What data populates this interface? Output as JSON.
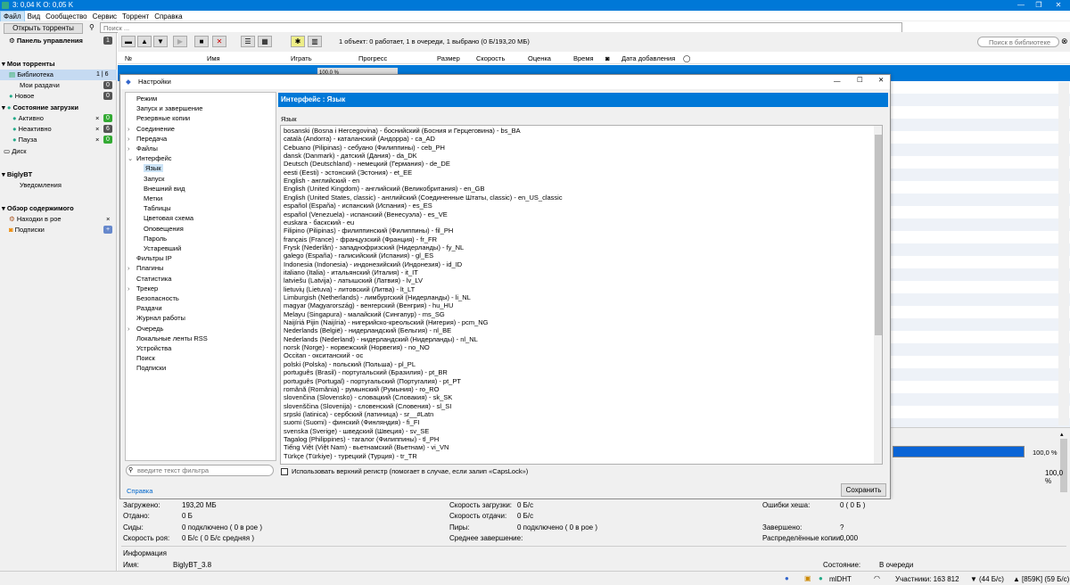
{
  "app": {
    "title": "3: 0,04 K O: 0,05 K"
  },
  "menu": [
    "Файл",
    "Вид",
    "Сообщество",
    "Сервис",
    "Торрент",
    "Справка"
  ],
  "left": {
    "open_torrents": "Открыть торренты",
    "control_panel": "Панель управления",
    "control_panel_badge": "1",
    "my_torrents": "Мои торренты",
    "library": "Библиотека",
    "library_count": "1 | 6",
    "my_seeds": "Мои раздачи",
    "my_seeds_badge": "0",
    "new": "Новое",
    "new_badge": "0",
    "download_state": "Состояние загрузки",
    "active": "Активно",
    "active_badge": "0",
    "inactive": "Неактивно",
    "inactive_badge": "6",
    "paused": "Пауза",
    "paused_badge": "0",
    "disk": "Диск",
    "biglybt": "BiglyBT",
    "notifications": "Уведомления",
    "content_overview": "Обзор содержимого",
    "swarm_finds": "Находки в рое",
    "subscriptions": "Подписки"
  },
  "search": {
    "placeholder": "Поиск ...",
    "library_placeholder": "Поиск в библиотеке"
  },
  "toolbar": {
    "status": "1 объект: 0 работает, 1 в очереди, 1 выбрано (0 Б/193,20 МБ)"
  },
  "columns": [
    "№",
    "Имя",
    "Играть",
    "Прогресс",
    "Размер",
    "Скорость",
    "Оценка",
    "Время",
    "Дата добавления"
  ],
  "row": {
    "progress": "100,0 %"
  },
  "dialog": {
    "title": "Настройки",
    "header": "Интерфейс : Язык",
    "lang_label": "Язык",
    "filter_placeholder": "введите текст фильтра",
    "uppercase": "Использовать верхний регистр (помогает в случае, если залип «CapsLock»)",
    "help": "Справка",
    "save": "Сохранить",
    "tree": [
      {
        "l": "Режим",
        "d": 0,
        "a": ""
      },
      {
        "l": "Запуск и завершение",
        "d": 0,
        "a": ""
      },
      {
        "l": "Резервные копии",
        "d": 0,
        "a": ""
      },
      {
        "l": "Соединение",
        "d": 0,
        "a": "›"
      },
      {
        "l": "Передача",
        "d": 0,
        "a": "›"
      },
      {
        "l": "Файлы",
        "d": 0,
        "a": "›"
      },
      {
        "l": "Интерфейс",
        "d": 0,
        "a": "⌄"
      },
      {
        "l": "Язык",
        "d": 1,
        "a": "",
        "sel": true
      },
      {
        "l": "Запуск",
        "d": 1,
        "a": ""
      },
      {
        "l": "Внешний вид",
        "d": 1,
        "a": ""
      },
      {
        "l": "Метки",
        "d": 1,
        "a": ""
      },
      {
        "l": "Таблицы",
        "d": 1,
        "a": ""
      },
      {
        "l": "Цветовая схема",
        "d": 1,
        "a": ""
      },
      {
        "l": "Оповещения",
        "d": 1,
        "a": ""
      },
      {
        "l": "Пароль",
        "d": 1,
        "a": ""
      },
      {
        "l": "Устаревший",
        "d": 1,
        "a": ""
      },
      {
        "l": "Фильтры IP",
        "d": 0,
        "a": ""
      },
      {
        "l": "Плагины",
        "d": 0,
        "a": "›"
      },
      {
        "l": "Статистика",
        "d": 0,
        "a": ""
      },
      {
        "l": "Трекер",
        "d": 0,
        "a": "›"
      },
      {
        "l": "Безопасность",
        "d": 0,
        "a": ""
      },
      {
        "l": "Раздачи",
        "d": 0,
        "a": ""
      },
      {
        "l": "Журнал работы",
        "d": 0,
        "a": ""
      },
      {
        "l": "Очередь",
        "d": 0,
        "a": "›"
      },
      {
        "l": "Локальные ленты RSS",
        "d": 0,
        "a": ""
      },
      {
        "l": "Устройства",
        "d": 0,
        "a": ""
      },
      {
        "l": "Поиск",
        "d": 0,
        "a": ""
      },
      {
        "l": "Подписки",
        "d": 0,
        "a": ""
      }
    ],
    "languages": [
      "bosanski (Bosna i Hercegovina) - боснийский (Босния и Герцеговина) - bs_BA",
      "català (Andorra) - каталанский (Андорра) - ca_AD",
      "Cebuano (Pilipinas) - себуано (Филиппины) - ceb_PH",
      "dansk (Danmark) - датский (Дания) - da_DK",
      "Deutsch (Deutschland) - немецкий (Германия) - de_DE",
      "eesti (Eesti) - эстонский (Эстония) - et_EE",
      "English - английский - en",
      "English (United Kingdom) - английский (Великобритания) - en_GB",
      "English (United States, classic) - английский (Соединенные Штаты, classic) - en_US_classic",
      "español (España) - испанский (Испания) - es_ES",
      "español (Venezuela) - испанский (Венесуэла) - es_VE",
      "euskara - баскский - eu",
      "Filipino (Pilipinas) - филиппинский (Филиппины) - fil_PH",
      "français (France) - французский (Франция) - fr_FR",
      "Frysk (Nederlân) - западнофризский (Нидерланды) - fy_NL",
      "galego (España) - галисийский (Испания) - gl_ES",
      "Indonesia (Indonesia) - индонезийский (Индонезия) - id_ID",
      "italiano (Italia) - итальянский (Италия) - it_IT",
      "latviešu (Latvija) - латышский (Латвия) - lv_LV",
      "lietuvių (Lietuva) - литовский (Литва) - lt_LT",
      "Limburgish (Netherlands) - лимбургский (Нидерланды) - li_NL",
      "magyar (Magyarország) - венгерский (Венгрия) - hu_HU",
      "Melayu (Singapura) - малайский (Сингапур) - ms_SG",
      "Naijíriá Pijin (Naijíria) - нигерийско-креольский (Нигерия) - pcm_NG",
      "Nederlands (België) - нидерландский (Бельгия) - nl_BE",
      "Nederlands (Nederland) - нидерландский (Нидерланды) - nl_NL",
      "norsk (Norge) - норвежский (Норвегия) - no_NO",
      "Occitan - окситанский - oc",
      "polski (Polska) - польский (Польша) - pl_PL",
      "português (Brasil) - португальский (Бразилия) - pt_BR",
      "português (Portugal) - португальский (Португалия) - pt_PT",
      "română (România) - румынский (Румыния) - ro_RO",
      "slovenčina (Slovensko) - словацкий (Словакия) - sk_SK",
      "slovenščina (Slovenija) - словенский (Словения) - sl_SI",
      "srpski (latinica) - сербский (латиница) - sr__#Latn",
      "suomi (Suomi) - финский (Финляндия) - fi_FI",
      "svenska (Sverige) - шведский (Швеция) - sv_SE",
      "Tagalog (Philippines) - тагалог (Филиппины) - tl_PH",
      "Tiếng Việt (Việt Nam) - вьетнамский (Вьетнам) - vi_VN",
      "Türkçe (Türkiye) - турецкий (Турция) - tr_TR"
    ]
  },
  "info": {
    "downloaded_l": "Загружено:",
    "downloaded": "193,20 МБ",
    "uploaded_l": "Отдано:",
    "uploaded": "0 Б",
    "seeds_l": "Сиды:",
    "seeds": "0 подключено ( 0 в рое )",
    "swarm_speed_l": "Скорость роя:",
    "swarm_speed": "0 Б/с ( 0 Б/с средняя )",
    "dl_speed_l": "Скорость загрузки:",
    "dl_speed": "0 Б/с",
    "ul_speed_l": "Скорость отдачи:",
    "ul_speed": "0 Б/с",
    "peers_l": "Пиры:",
    "peers": "0 подключено ( 0 в рое )",
    "avg_complete_l": "Среднее завершение:",
    "hash_errors_l": "Ошибки хеша:",
    "hash_errors": "0 ( 0 Б )",
    "completed_l": "Завершено:",
    "completed": "?",
    "distributed_l": "Распределённые копии:",
    "distributed": "0,000",
    "section": "Информация",
    "name_l": "Имя:",
    "name": "BiglyBT_3.8",
    "state_l": "Состояние:",
    "state": "В очереди",
    "pct": "100,0 %",
    "pct2": "100,0 %"
  },
  "status": {
    "mldht": "mlDHT",
    "users": "Участники: 163 812",
    "down": "(44 Б/с)",
    "up": "[859K] (59 Б/с)"
  }
}
